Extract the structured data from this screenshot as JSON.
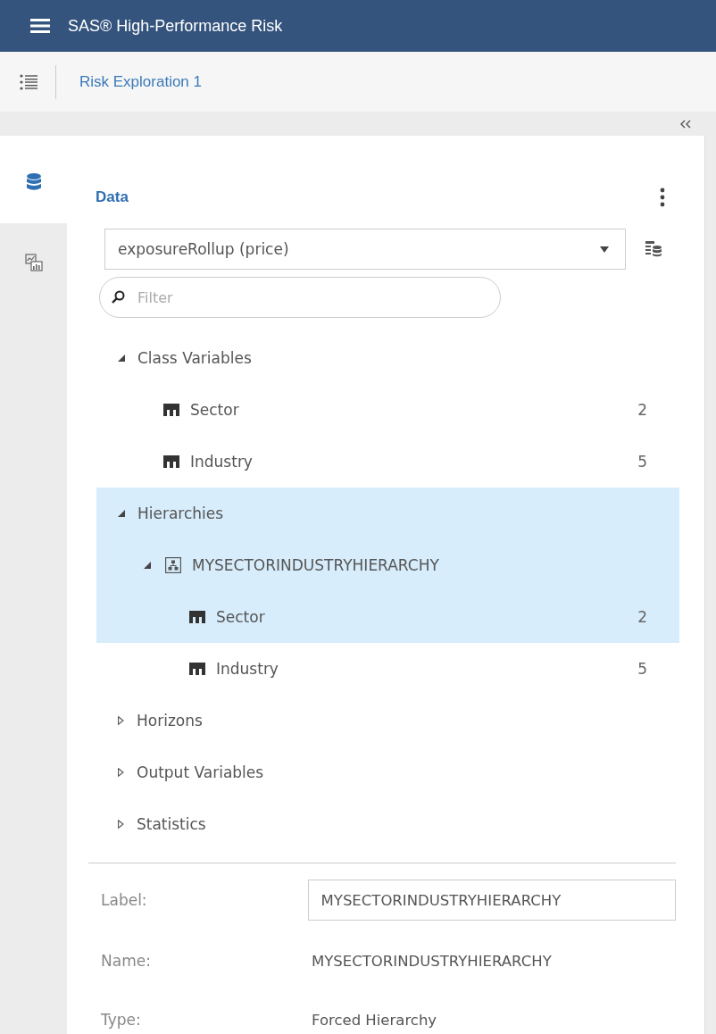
{
  "app_title": "SAS® High-Performance Risk",
  "document_tab": "Risk Exploration 1",
  "rail": [
    {
      "kind": "data",
      "selected": true
    },
    {
      "kind": "chart",
      "selected": false
    }
  ],
  "panel": {
    "title": "Data",
    "source": {
      "value": "exposureRollup (price)"
    },
    "filter": {
      "placeholder": "Filter"
    }
  },
  "tree": [
    {
      "kind": "group",
      "label": "Class Variables",
      "expanded": true,
      "selected": false,
      "children": [
        {
          "kind": "variable",
          "label": "Sector",
          "count": "2",
          "selected": false
        },
        {
          "kind": "variable",
          "label": "Industry",
          "count": "5",
          "selected": false
        }
      ]
    },
    {
      "kind": "group",
      "label": "Hierarchies",
      "expanded": true,
      "selected": true,
      "children": [
        {
          "kind": "hierarchy",
          "label": "MYSECTORINDUSTRYHIERARCHY",
          "expanded": true,
          "selected": true,
          "children": [
            {
              "kind": "variable",
              "label": "Sector",
              "count": "2",
              "selected": true
            },
            {
              "kind": "variable",
              "label": "Industry",
              "count": "5",
              "selected": false
            }
          ]
        }
      ]
    },
    {
      "kind": "group",
      "label": "Horizons",
      "expanded": false,
      "selected": false
    },
    {
      "kind": "group",
      "label": "Output Variables",
      "expanded": false,
      "selected": false
    },
    {
      "kind": "group",
      "label": "Statistics",
      "expanded": false,
      "selected": false
    }
  ],
  "properties": [
    {
      "kind": "input",
      "label": "Label:",
      "value": "MYSECTORINDUSTRYHIERARCHY"
    },
    {
      "kind": "text",
      "label": "Name:",
      "value": "MYSECTORINDUSTRYHIERARCHY"
    },
    {
      "kind": "text",
      "label": "Type:",
      "value": "Forced Hierarchy"
    }
  ]
}
